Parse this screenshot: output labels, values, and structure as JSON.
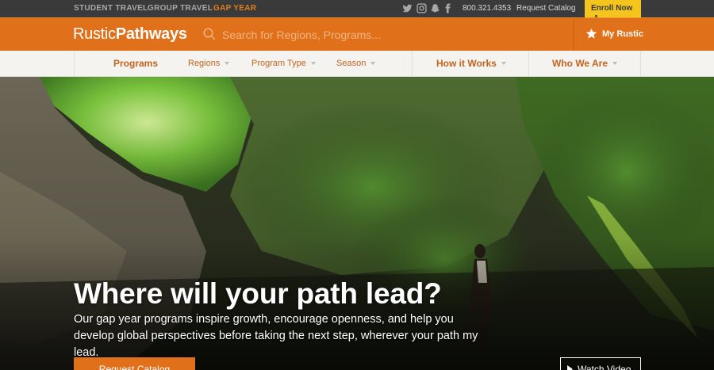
{
  "topbar": {
    "segments": [
      "STUDENT TRAVEL",
      "GROUP TRAVEL",
      "GAP YEAR"
    ],
    "active_segment": "GAP YEAR",
    "social_icons": [
      "twitter-icon",
      "instagram-icon",
      "snapchat-icon",
      "facebook-icon"
    ],
    "phone": "800.321.4353",
    "request_catalog": "Request Catalog",
    "enroll": "Enroll Now"
  },
  "header": {
    "logo_light": "Rustic",
    "logo_bold": "Pathways",
    "search_placeholder": "Search for Regions, Programs...",
    "my_rustic": "My Rustic"
  },
  "nav": {
    "programs": "Programs",
    "regions": "Regions",
    "program_type": "Program Type",
    "season": "Season",
    "how_it_works": "How it Works",
    "who_we_are": "Who We Are"
  },
  "hero": {
    "title": "Where will your path lead?",
    "subtitle": "Our gap year programs inspire growth, encourage openness, and help you develop global perspectives before taking the next step, wherever your path my lead.",
    "request_button": "Request Catalog",
    "video_button": "Watch Video"
  },
  "colors": {
    "brand_orange": "#e0701a",
    "enroll_yellow": "#f4c51d",
    "topbar": "#3a3a3a"
  }
}
